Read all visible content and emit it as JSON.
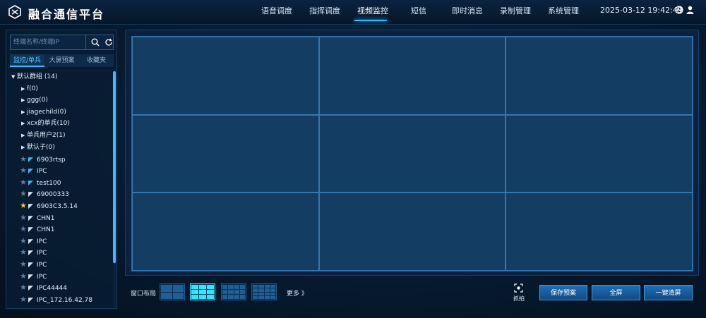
{
  "app": {
    "title": "融合通信平台"
  },
  "nav": {
    "items": [
      {
        "label": "语音调度"
      },
      {
        "label": "指挥调度"
      },
      {
        "label": "视频监控",
        "active": true
      },
      {
        "label": "短信"
      },
      {
        "label": "即时消息"
      },
      {
        "label": "录制管理"
      },
      {
        "label": "系统管理"
      }
    ],
    "clock": "2025-03-12 19:42:49",
    "icons": [
      "globe-icon",
      "user-icon"
    ]
  },
  "sidebar": {
    "search": {
      "placeholder": "终端名称/终端IP",
      "value": ""
    },
    "tabs": [
      {
        "label": "监控/单兵",
        "active": true
      },
      {
        "label": "大屏预案"
      },
      {
        "label": "收藏夹"
      }
    ],
    "tree": {
      "root": {
        "label": "默认群组  (14)"
      },
      "groups": [
        {
          "label": "f(0)"
        },
        {
          "label": "ggg(0)"
        },
        {
          "label": "jiagechild(0)"
        },
        {
          "label": "xcx的单兵(10)"
        },
        {
          "label": "单兵用户2(1)"
        },
        {
          "label": "默认子(0)"
        }
      ],
      "devices": [
        {
          "label": "6903rtsp",
          "online": true,
          "favorite": false
        },
        {
          "label": "IPC",
          "online": true,
          "favorite": false
        },
        {
          "label": "test100",
          "online": true,
          "favorite": false
        },
        {
          "label": "69000333",
          "online": false,
          "favorite": false
        },
        {
          "label": "6903C3.5.14",
          "online": false,
          "favorite": true
        },
        {
          "label": "CHN1",
          "online": false,
          "favorite": false
        },
        {
          "label": "CHN1",
          "online": false,
          "favorite": false
        },
        {
          "label": "IPC",
          "online": false,
          "favorite": false
        },
        {
          "label": "IPC",
          "online": false,
          "favorite": false
        },
        {
          "label": "IPC",
          "online": false,
          "favorite": false
        },
        {
          "label": "IPC",
          "online": false,
          "favorite": false
        },
        {
          "label": "IPC44444",
          "online": false,
          "favorite": false
        },
        {
          "label": "IPC_172.16.42.78",
          "online": false,
          "favorite": false
        }
      ]
    }
  },
  "video": {
    "rows": 3,
    "cols": 3
  },
  "toolbar": {
    "layout_label": "窗口布局",
    "layouts": [
      {
        "grid": "2x2",
        "active": false
      },
      {
        "grid": "3x3",
        "active": true
      },
      {
        "grid": "4x3",
        "active": false
      },
      {
        "grid": "4x4",
        "active": false
      }
    ],
    "more_label": "更多 》",
    "capture_label": "抓拍",
    "save_label": "保存预案",
    "fullscreen_label": "全屏",
    "clear_label": "一键清屏"
  },
  "colors": {
    "accent": "#3dbbff",
    "active_layout": "#2fe6ff",
    "favorite": "#f6c431"
  }
}
